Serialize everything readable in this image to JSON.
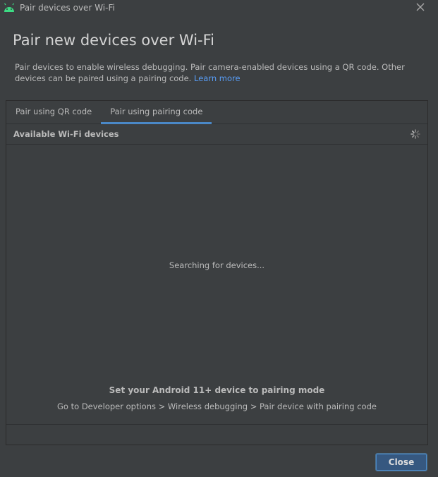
{
  "window": {
    "title": "Pair devices over Wi-Fi"
  },
  "dialog": {
    "heading": "Pair new devices over Wi-Fi",
    "description": "Pair devices to enable wireless debugging. Pair camera-enabled devices using a QR code. Other devices can be paired using a pairing code.",
    "learn_more": "Learn more"
  },
  "tabs": [
    {
      "label": "Pair using QR code",
      "active": false
    },
    {
      "label": "Pair using pairing code",
      "active": true
    }
  ],
  "devices_panel": {
    "title": "Available Wi-Fi devices",
    "status": "Searching for devices...",
    "instruction_title": "Set your Android 11+ device to pairing mode",
    "instruction_steps": "Go to Developer options > Wireless debugging > Pair device with pairing code"
  },
  "footer": {
    "close_label": "Close"
  },
  "colors": {
    "background": "#3c3f41",
    "accent": "#4a88c7",
    "link": "#589df6",
    "android_green": "#3ddc84"
  }
}
